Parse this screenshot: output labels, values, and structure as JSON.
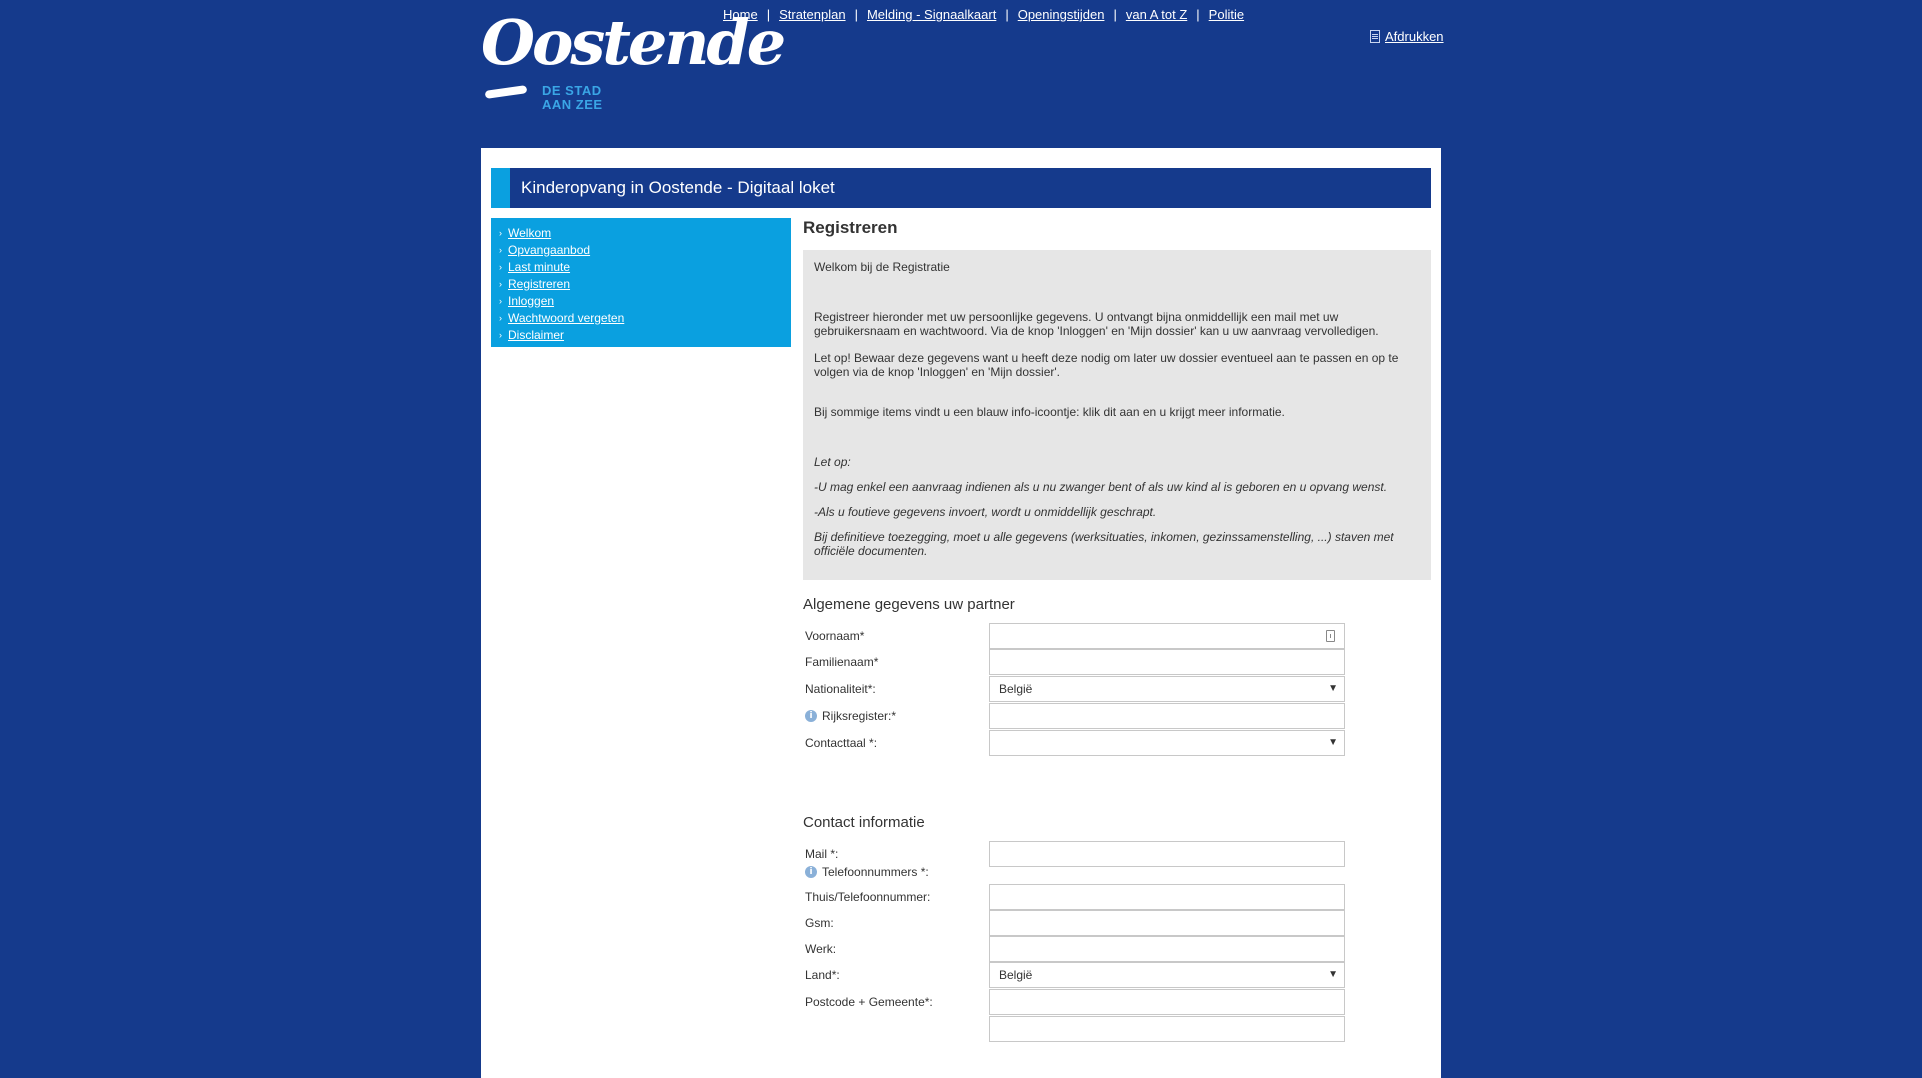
{
  "logo": {
    "word": "Oostende",
    "sub_line1": "DE STAD",
    "sub_line2": "AAN ZEE"
  },
  "topnav": [
    "Home",
    "Stratenplan",
    "Melding - Signaalkaart",
    "Openingstijden",
    "van A tot Z",
    "Politie"
  ],
  "print": {
    "label": "Afdrukken",
    "icon": "document-icon"
  },
  "banner": {
    "title": "Kinderopvang in Oostende - Digitaal loket"
  },
  "sidebar": {
    "items": [
      "Welkom",
      "Opvangaanbod",
      "Last minute",
      "Registreren",
      "Inloggen",
      "Wachtwoord vergeten",
      "Disclaimer"
    ]
  },
  "main": {
    "heading": "Registreren",
    "info": {
      "welcome": "Welkom bij de Registratie",
      "p1": "Registreer hieronder met uw persoonlijke gegevens. U ontvangt bijna onmiddellijk een mail met uw gebruikersnaam en wachtwoord. Via de knop 'Inloggen' en 'Mijn dossier' kan u uw aanvraag vervolledigen.",
      "p2": "Let op! Bewaar deze gegevens want u heeft deze nodig om later uw dossier eventueel aan te passen en op te volgen via de knop 'Inloggen' en 'Mijn dossier'.",
      "p3": "Bij sommige items vindt u een blauw info-icoontje: klik dit aan en u krijgt meer informatie.",
      "i1": "Let op:",
      "i2": "-U mag enkel een aanvraag indienen als u nu zwanger bent of als uw kind al is geboren en u opvang wenst.",
      "i3": "-Als u foutieve gegevens invoert, wordt u onmiddellijk geschrapt.",
      "i4": "Bij definitieve toezegging, moet u alle gegevens (werksituaties, inkomen, gezinssamenstelling, ...) staven met officiële documenten."
    },
    "section1": {
      "title": "Algemene gegevens uw partner",
      "fields": {
        "voornaam": {
          "label": "Voornaam*",
          "value": ""
        },
        "familienaam": {
          "label": "Familienaam*",
          "value": ""
        },
        "nationaliteit": {
          "label": "Nationaliteit*:",
          "value": "België"
        },
        "rijksregister": {
          "label": "Rijksregister:*",
          "value": ""
        },
        "contacttaal": {
          "label": "Contacttaal *:",
          "value": ""
        }
      }
    },
    "section2": {
      "title": "Contact informatie",
      "fields": {
        "mail": {
          "label": "Mail *:",
          "value": ""
        },
        "telefoonnummers": {
          "label": "Telefoonnummers *:"
        },
        "thuis": {
          "label": "Thuis/Telefoonnummer:",
          "value": ""
        },
        "gsm": {
          "label": "Gsm:",
          "value": ""
        },
        "werk": {
          "label": "Werk:",
          "value": ""
        },
        "land": {
          "label": "Land*:",
          "value": "België"
        },
        "postcode": {
          "label": "Postcode + Gemeente*:",
          "value": ""
        }
      }
    }
  },
  "colors": {
    "background": "#153a8c",
    "accent": "#0aa0e0",
    "info_bg": "#e6e6e6"
  }
}
